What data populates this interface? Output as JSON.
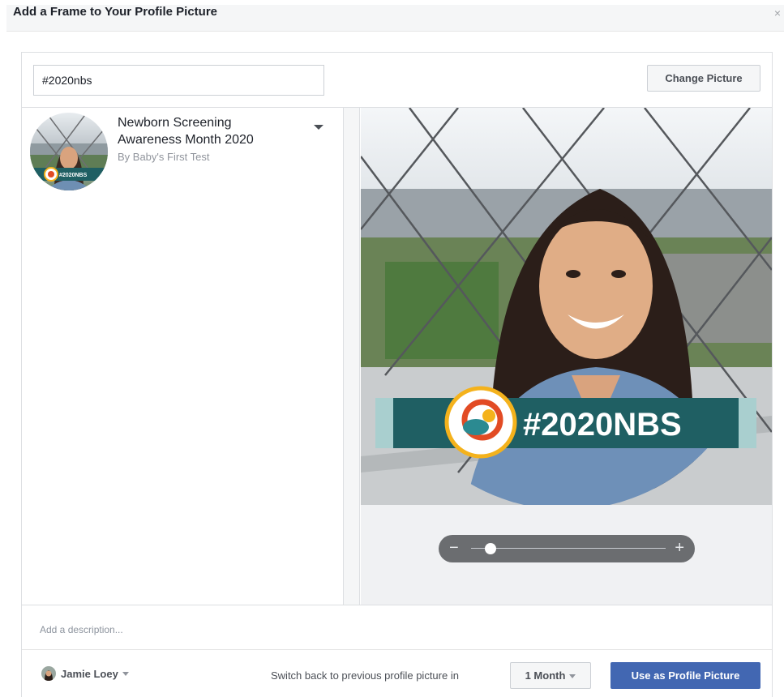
{
  "dialog": {
    "title": "Add a Frame to Your Profile Picture",
    "close_glyph": "×"
  },
  "search": {
    "value": "#2020nbs",
    "icon": "none"
  },
  "buttons": {
    "change_picture": "Change Picture",
    "use_as_profile": "Use as Profile Picture"
  },
  "frame_result": {
    "name": "Newborn Screening Awareness Month 2020",
    "author": "By Baby's First Test",
    "thumb_badge": "#2020NBS",
    "dropdown_icon": "caret-down-icon"
  },
  "preview": {
    "frame_banner_text": "#2020NBS",
    "banner_color": "#1f5f63",
    "banner_light_color": "#a9cfcf",
    "logo_colors": [
      "#f4b21c",
      "#e24b24",
      "#2b8a91"
    ],
    "zoom_minus": "−",
    "zoom_plus": "+",
    "zoom_level": 0.05
  },
  "description": {
    "placeholder": "Add a description..."
  },
  "footer": {
    "audience_name": "Jamie Loey",
    "switch_back_text": "Switch back to previous profile picture in",
    "duration_value": "1 Month"
  },
  "colors": {
    "primary_blue": "#4267b2",
    "header_bg": "#f5f6f7"
  }
}
